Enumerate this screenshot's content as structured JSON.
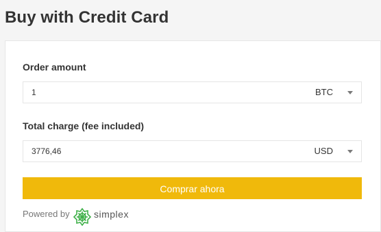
{
  "page": {
    "title": "Buy with Credit Card"
  },
  "form": {
    "order_amount_label": "Order amount",
    "order_amount_value": "1",
    "order_currency": "BTC",
    "total_charge_label": "Total charge (fee included)",
    "total_charge_value": "3776,46",
    "charge_currency": "USD",
    "submit_label": "Comprar ahora"
  },
  "footer": {
    "powered_by": "Powered by",
    "brand": "simplex",
    "logo_icon": "simplex-logo-icon"
  },
  "colors": {
    "accent": "#f0b90b",
    "logo_green": "#3fb049",
    "background": "#f5f5f5"
  }
}
